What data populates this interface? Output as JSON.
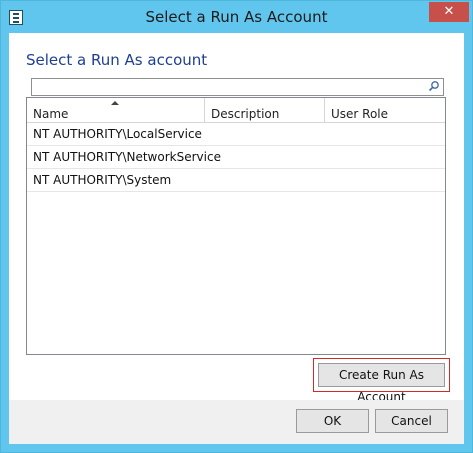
{
  "window": {
    "title": "Select a Run As Account",
    "close_glyph": "✕"
  },
  "main": {
    "heading": "Select a Run As account",
    "search": {
      "value": "",
      "placeholder": ""
    },
    "columns": [
      "Name",
      "Description",
      "User Role"
    ],
    "sorted_column": "Name",
    "rows": [
      {
        "name": "NT AUTHORITY\\LocalService",
        "description": "",
        "user_role": ""
      },
      {
        "name": "NT AUTHORITY\\NetworkService",
        "description": "",
        "user_role": ""
      },
      {
        "name": "NT AUTHORITY\\System",
        "description": "",
        "user_role": ""
      }
    ],
    "create_button": "Create Run As Account"
  },
  "footer": {
    "ok_label": "OK",
    "cancel_label": "Cancel"
  },
  "colors": {
    "titlebar": "#61c6ee",
    "heading": "#1e3f91",
    "close": "#c7504b",
    "highlight_box": "#d02a2a"
  },
  "icons": [
    "app-icon",
    "search-icon",
    "sort-ascending-icon",
    "close-icon"
  ]
}
